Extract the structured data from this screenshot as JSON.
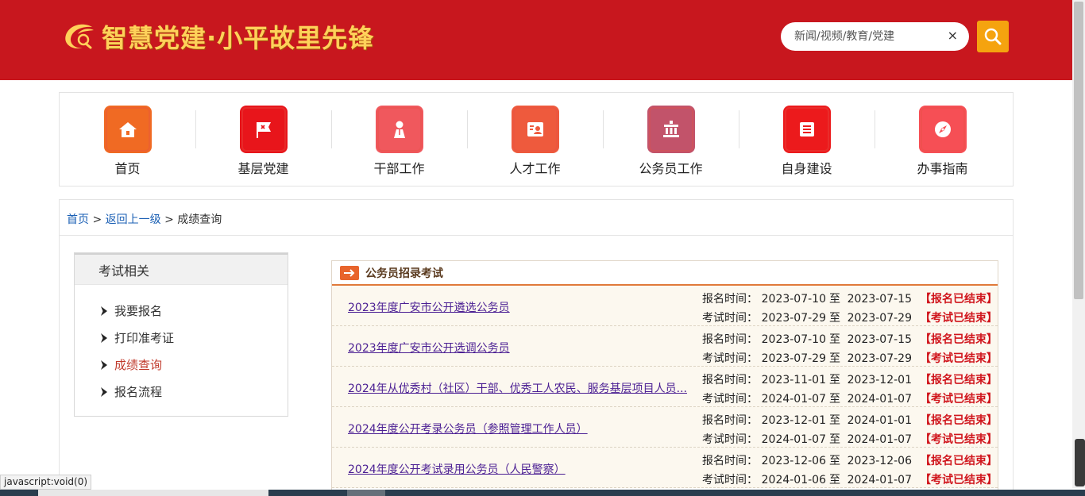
{
  "header": {
    "logo_text": "智慧党建·小平故里先锋",
    "search_placeholder": "新闻/视频/教育/党建",
    "clear_symbol": "×"
  },
  "nav": {
    "items": [
      {
        "label": "首页",
        "icon": "home-icon",
        "color": "#f06a23"
      },
      {
        "label": "基层党建",
        "icon": "party-flag-icon",
        "color": "#e8151b"
      },
      {
        "label": "干部工作",
        "icon": "cadre-person-icon",
        "color": "#f0585d"
      },
      {
        "label": "人才工作",
        "icon": "talent-card-icon",
        "color": "#ee5a3d"
      },
      {
        "label": "公务员工作",
        "icon": "civil-building-icon",
        "color": "#c2536a"
      },
      {
        "label": "自身建设",
        "icon": "document-list-icon",
        "color": "#ec1a1c"
      },
      {
        "label": "办事指南",
        "icon": "compass-icon",
        "color": "#f64f55"
      }
    ]
  },
  "breadcrumb": {
    "home": "首页",
    "sep": ">",
    "back": "返回上一级",
    "current": "成绩查询"
  },
  "sidebar": {
    "title": "考试相关",
    "items": [
      "我要报名",
      "打印准考证",
      "成绩查询",
      "报名流程"
    ],
    "active_index": 2
  },
  "panel": {
    "title": "公务员招录考试",
    "labels": {
      "reg": "报名时间：",
      "exam": "考试时间：",
      "to": "至"
    },
    "rows": [
      {
        "title": "2023年度广安市公开遴选公务员",
        "reg_start": "2023-07-10",
        "reg_end": "2023-07-15",
        "reg_status": "【报名已结束】",
        "exam_start": "2023-07-29",
        "exam_end": "2023-07-29",
        "exam_status": "【考试已结束】"
      },
      {
        "title": "2023年度广安市公开选调公务员",
        "reg_start": "2023-07-10",
        "reg_end": "2023-07-15",
        "reg_status": "【报名已结束】",
        "exam_start": "2023-07-29",
        "exam_end": "2023-07-29",
        "exam_status": "【考试已结束】"
      },
      {
        "title": "2024年从优秀村（社区）干部、优秀工人农民、服务基层项目人员...",
        "reg_start": "2023-11-01",
        "reg_end": "2023-12-01",
        "reg_status": "【报名已结束】",
        "exam_start": "2024-01-07",
        "exam_end": "2024-01-07",
        "exam_status": "【考试已结束】"
      },
      {
        "title": "2024年度公开考录公务员（参照管理工作人员）",
        "reg_start": "2023-12-01",
        "reg_end": "2024-01-01",
        "reg_status": "【报名已结束】",
        "exam_start": "2024-01-07",
        "exam_end": "2024-01-07",
        "exam_status": "【考试已结束】"
      },
      {
        "title": "2024年度公开考试录用公务员（人民警察）",
        "reg_start": "2023-12-06",
        "reg_end": "2023-12-06",
        "reg_status": "【报名已结束】",
        "exam_start": "2024-01-06",
        "exam_end": "2024-01-07",
        "exam_status": "【考试已结束】"
      }
    ]
  },
  "statusbar": {
    "link_tip": "javascript:void(0)"
  },
  "colors": {
    "header_red": "#c8171e",
    "logo_gold": "#ffd15a",
    "search_orange": "#f5a30f",
    "status_red": "#d0161d",
    "link_purple": "#4b1f93",
    "link_blue": "#1a5fb4",
    "active_red": "#c0392b"
  }
}
